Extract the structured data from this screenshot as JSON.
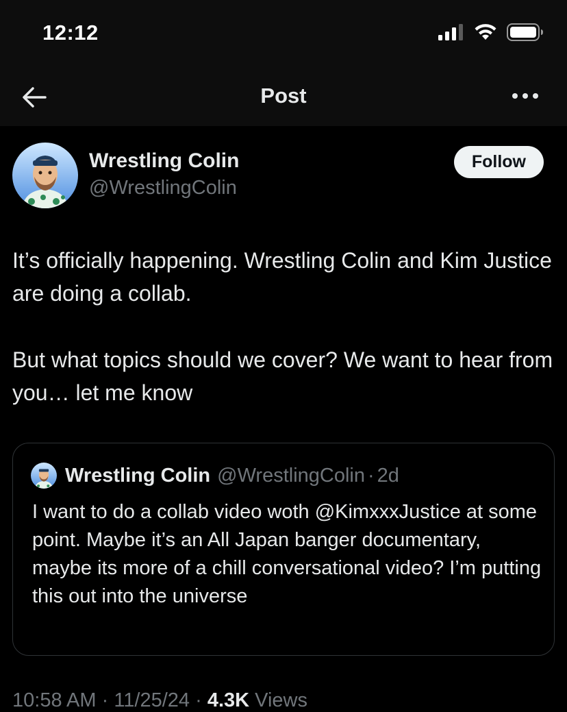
{
  "status_bar": {
    "time": "12:12"
  },
  "nav": {
    "title": "Post"
  },
  "author": {
    "name": "Wrestling Colin",
    "handle": "@WrestlingColin",
    "follow_label": "Follow"
  },
  "tweet": {
    "paragraphs": [
      "It’s officially happening. Wrestling Colin and Kim Justice are doing a collab.",
      "But what topics should we cover? We want to hear from you… let me know"
    ]
  },
  "quoted_tweet": {
    "name": "Wrestling Colin",
    "handle": "@WrestlingColin",
    "separator": "·",
    "time": "2d",
    "text": "I want to do a collab video woth @KimxxxJustice at some point. Maybe it’s an All Japan banger documentary, maybe its more of a chill conversational video? I’m putting this out into the universe"
  },
  "meta": {
    "time": "10:58 AM",
    "separator": " · ",
    "date": "11/25/24",
    "views_count": "4.3K",
    "views_label": "Views"
  },
  "colors": {
    "background": "#000000",
    "text_primary": "#e7e9ea",
    "text_secondary": "#71767b",
    "border": "#2f3336",
    "follow_bg": "#eff3f4"
  },
  "icons": {
    "back": "arrow-left-icon",
    "more": "more-horizontal-icon",
    "signal": "cellular-signal-icon",
    "wifi": "wifi-icon",
    "battery": "battery-icon"
  }
}
